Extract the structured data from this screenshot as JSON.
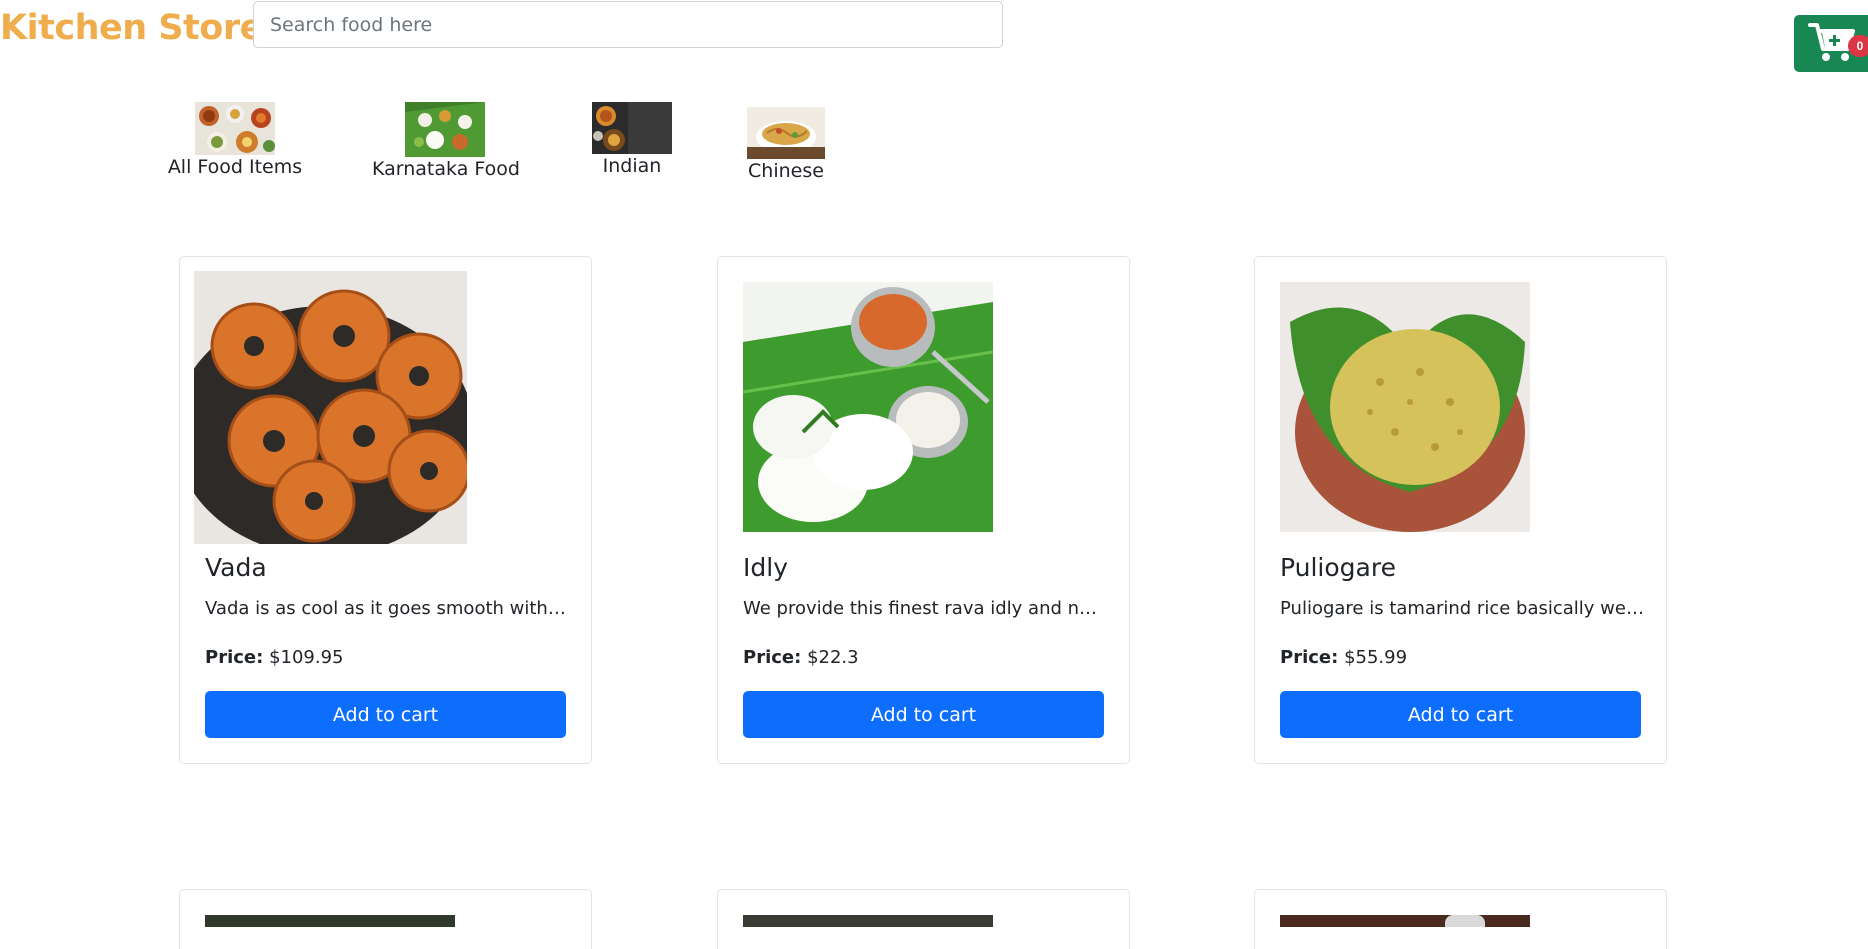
{
  "header": {
    "brand": "Kitchen Store",
    "search_placeholder": "Search food here",
    "cart_count": "0"
  },
  "categories": [
    {
      "label": "All Food Items",
      "icon": "food-platter-image"
    },
    {
      "label": "Karnataka Food",
      "icon": "banana-leaf-meal-image"
    },
    {
      "label": "Indian",
      "icon": "indian-curry-image"
    },
    {
      "label": "Chinese",
      "icon": "noodles-image"
    }
  ],
  "products": [
    {
      "name": "Vada",
      "description": "Vada is as cool as it goes smooth with i...",
      "price_label": "Price:",
      "price": "$109.95",
      "button": "Add to cart",
      "image": "vada-photo"
    },
    {
      "name": "Idly",
      "description": "We provide this finest rava idly and nor...",
      "price_label": "Price:",
      "price": "$22.3",
      "button": "Add to cart",
      "image": "idly-photo"
    },
    {
      "name": "Puliogare",
      "description": "Puliogare is tamarind rice basically we ...",
      "price_label": "Price:",
      "price": "$55.99",
      "button": "Add to cart",
      "image": "puliogare-photo"
    }
  ],
  "colors": {
    "brand": "#f0ad4e",
    "primary_button": "#0d6efd",
    "cart_button": "#198754",
    "badge": "#dc3545"
  }
}
